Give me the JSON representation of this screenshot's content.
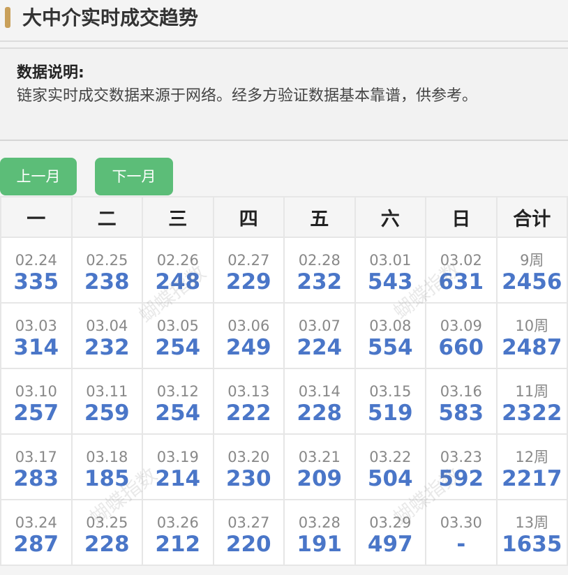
{
  "header": {
    "title": "大中介实时成交趋势"
  },
  "note": {
    "label": "数据说明:",
    "text": "链家实时成交数据来源于网络。经多方验证数据基本靠谱，供参考。"
  },
  "nav": {
    "prev_label": "上一月",
    "next_label": "下一月"
  },
  "calendar": {
    "headers": [
      "一",
      "二",
      "三",
      "四",
      "五",
      "六",
      "日",
      "合计"
    ],
    "rows": [
      {
        "cells": [
          {
            "date": "02.24",
            "value": "335"
          },
          {
            "date": "02.25",
            "value": "238"
          },
          {
            "date": "02.26",
            "value": "248"
          },
          {
            "date": "02.27",
            "value": "229"
          },
          {
            "date": "02.28",
            "value": "232"
          },
          {
            "date": "03.01",
            "value": "543"
          },
          {
            "date": "03.02",
            "value": "631"
          }
        ],
        "week": {
          "label": "9周",
          "total": "2456"
        }
      },
      {
        "cells": [
          {
            "date": "03.03",
            "value": "314"
          },
          {
            "date": "03.04",
            "value": "232"
          },
          {
            "date": "03.05",
            "value": "254"
          },
          {
            "date": "03.06",
            "value": "249"
          },
          {
            "date": "03.07",
            "value": "224"
          },
          {
            "date": "03.08",
            "value": "554"
          },
          {
            "date": "03.09",
            "value": "660"
          }
        ],
        "week": {
          "label": "10周",
          "total": "2487"
        }
      },
      {
        "cells": [
          {
            "date": "03.10",
            "value": "257"
          },
          {
            "date": "03.11",
            "value": "259"
          },
          {
            "date": "03.12",
            "value": "254"
          },
          {
            "date": "03.13",
            "value": "222"
          },
          {
            "date": "03.14",
            "value": "228"
          },
          {
            "date": "03.15",
            "value": "519"
          },
          {
            "date": "03.16",
            "value": "583"
          }
        ],
        "week": {
          "label": "11周",
          "total": "2322"
        }
      },
      {
        "cells": [
          {
            "date": "03.17",
            "value": "283"
          },
          {
            "date": "03.18",
            "value": "185"
          },
          {
            "date": "03.19",
            "value": "214"
          },
          {
            "date": "03.20",
            "value": "230"
          },
          {
            "date": "03.21",
            "value": "209"
          },
          {
            "date": "03.22",
            "value": "504"
          },
          {
            "date": "03.23",
            "value": "592"
          }
        ],
        "week": {
          "label": "12周",
          "total": "2217"
        }
      },
      {
        "cells": [
          {
            "date": "03.24",
            "value": "287"
          },
          {
            "date": "03.25",
            "value": "228"
          },
          {
            "date": "03.26",
            "value": "212"
          },
          {
            "date": "03.27",
            "value": "220"
          },
          {
            "date": "03.28",
            "value": "191"
          },
          {
            "date": "03.29",
            "value": "497"
          },
          {
            "date": "03.30",
            "value": "-"
          }
        ],
        "week": {
          "label": "13周",
          "total": "1635"
        }
      }
    ]
  },
  "watermark": "蝴蝶指数",
  "colors": {
    "accent_bar": "#c9a05a",
    "button": "#5cbd78",
    "value_text": "#4a76c8",
    "date_text": "#888888"
  }
}
